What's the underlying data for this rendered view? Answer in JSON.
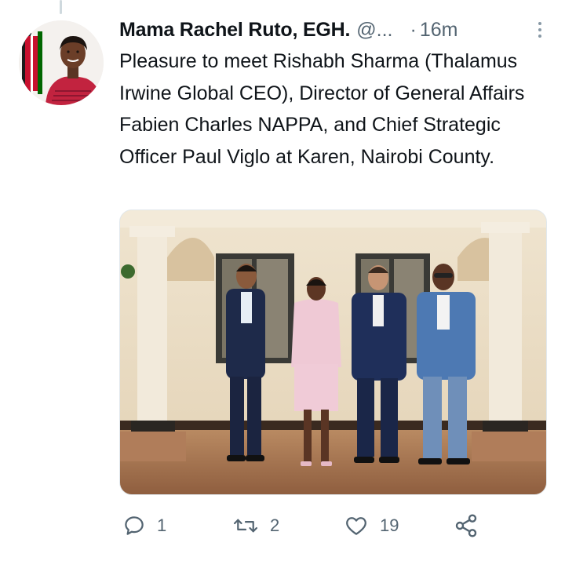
{
  "tweet": {
    "author": {
      "display_name": "Mama Rachel Ruto, EGH.",
      "handle": "@...",
      "avatar_icon": "profile-photo"
    },
    "separator": "·",
    "timestamp": "16m",
    "more_icon": "more-vertical-icon",
    "text": "Pleasure to meet Rishabh Sharma (Thalamus Irwine Global CEO), Director of General Affairs Fabien Charles NAPPA, and Chief Strategic Officer Paul Viglo at Karen, Nairobi County.",
    "media": {
      "description_icon": "photo"
    },
    "actions": {
      "reply": {
        "icon": "reply-icon",
        "count": "1"
      },
      "retweet": {
        "icon": "retweet-icon",
        "count": "2"
      },
      "like": {
        "icon": "heart-icon",
        "count": "19"
      },
      "share": {
        "icon": "share-icon"
      }
    }
  },
  "colors": {
    "text_primary": "#0f1419",
    "text_secondary": "#536471",
    "thread_line": "#cfd9de"
  }
}
